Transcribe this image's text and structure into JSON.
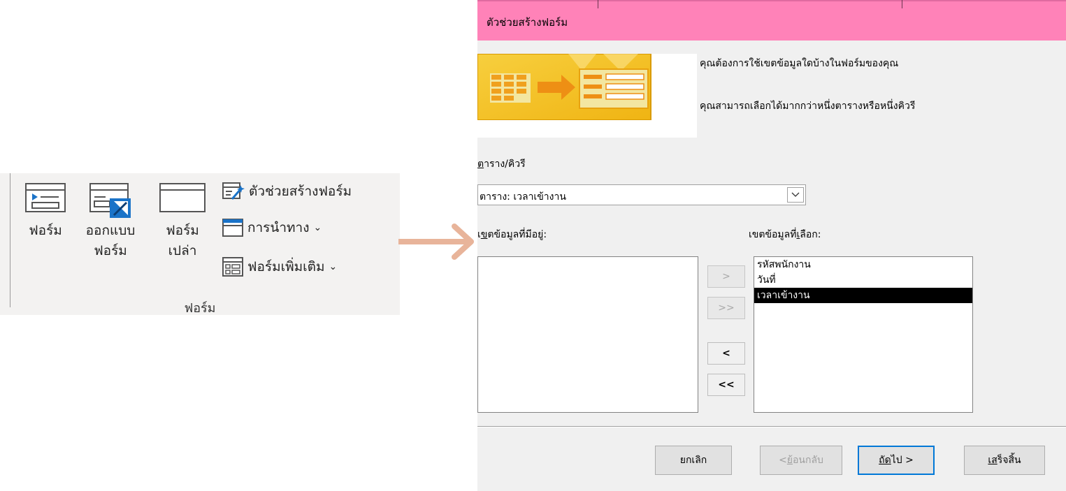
{
  "ribbon": {
    "buttons": [
      {
        "line1": "ฟอร์ม",
        "line2": ""
      },
      {
        "line1": "ออกแบบ",
        "line2": "ฟอร์ม"
      },
      {
        "line1": "ฟอร์ม",
        "line2": "เปล่า"
      }
    ],
    "small_items": [
      {
        "label": "ตัวช่วยสร้างฟอร์ม",
        "chevron": ""
      },
      {
        "label": "การนำทาง",
        "chevron": "⌄"
      },
      {
        "label": "ฟอร์มเพิ่มเติม",
        "chevron": "⌄"
      }
    ],
    "group_label": "ฟอร์ม"
  },
  "colors": {
    "arrow": "#e8b49a",
    "titlebar": "#ff82b8",
    "banner_gold": "#f5c21b",
    "default_button_border": "#0078d7"
  },
  "dialog": {
    "title": "ตัวช่วยสร้างฟอร์ม",
    "prompt1": "คุณต้องการใช้เขตข้อมูลใดบ้างในฟอร์มของคุณ",
    "prompt2": "คุณสามารถเลือกได้มากกว่าหนึ่งตารางหรือหนึ่งคิวรี",
    "table_query_label": "ตาราง/คิวรี",
    "table_query_mnemonic": "ต",
    "table_query_rest": "าราง/คิวรี",
    "table_query_value": "ตาราง: เวลาเข้างาน",
    "available_fields_label": "เขตข้อมูลที่มีอยู่:",
    "available_mnemonic_pre": "เ",
    "available_mnemonic": "ข",
    "available_rest": "ตข้อมูลที่มีอยู่:",
    "selected_fields_label": "เขตข้อมูลที่เลือก:",
    "selected_pre": "เขตข้อมูลที่",
    "selected_mnemonic": "เ",
    "selected_rest": "ลือก:",
    "available_fields": [],
    "selected_fields": [
      "รหัสพนักงาน",
      "วันที่",
      "เวลาเข้างาน"
    ],
    "selected_index": 2,
    "move_buttons": [
      ">",
      ">>",
      "<",
      "<<"
    ],
    "buttons": {
      "cancel": "ยกเลิก",
      "back_pre": "< ",
      "back_mn": "ย้",
      "back_rest": "อนกลับ",
      "next_mn": "ถัด",
      "next_rest": "ไป >",
      "finish_mn": "เส",
      "finish_rest": "ร็จสิ้น"
    }
  }
}
